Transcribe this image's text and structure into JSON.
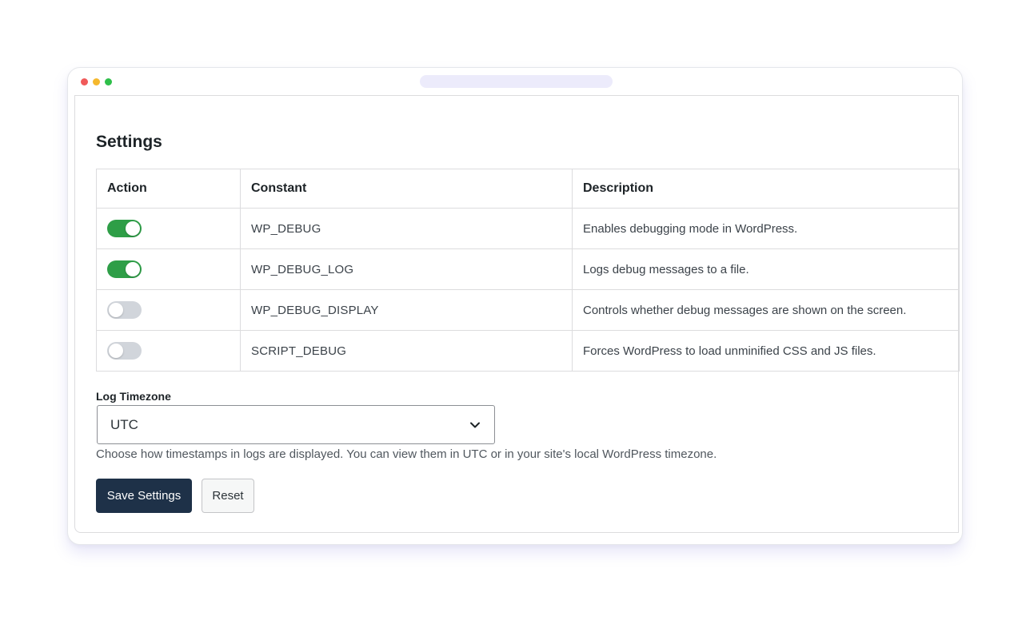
{
  "panel": {
    "title": "Settings"
  },
  "table": {
    "headers": [
      "Action",
      "Constant",
      "Description"
    ],
    "rows": [
      {
        "enabled": true,
        "constant": "WP_DEBUG",
        "description": "Enables debugging mode in WordPress."
      },
      {
        "enabled": true,
        "constant": "WP_DEBUG_LOG",
        "description": "Logs debug messages to a file."
      },
      {
        "enabled": false,
        "constant": "WP_DEBUG_DISPLAY",
        "description": "Controls whether debug messages are shown on the screen."
      },
      {
        "enabled": false,
        "constant": "SCRIPT_DEBUG",
        "description": "Forces WordPress to load unminified CSS and JS files."
      }
    ]
  },
  "timezone": {
    "label": "Log Timezone",
    "selected": "UTC",
    "help": "Choose how timestamps in logs are displayed. You can view them in UTC or in your site's local WordPress timezone."
  },
  "buttons": {
    "save": "Save Settings",
    "reset": "Reset"
  },
  "icons": {
    "dropdown": "chevron-down-icon"
  },
  "colors": {
    "toggle_on": "#2e9e47",
    "toggle_off": "#d1d5db",
    "primary": "#1e3148"
  }
}
